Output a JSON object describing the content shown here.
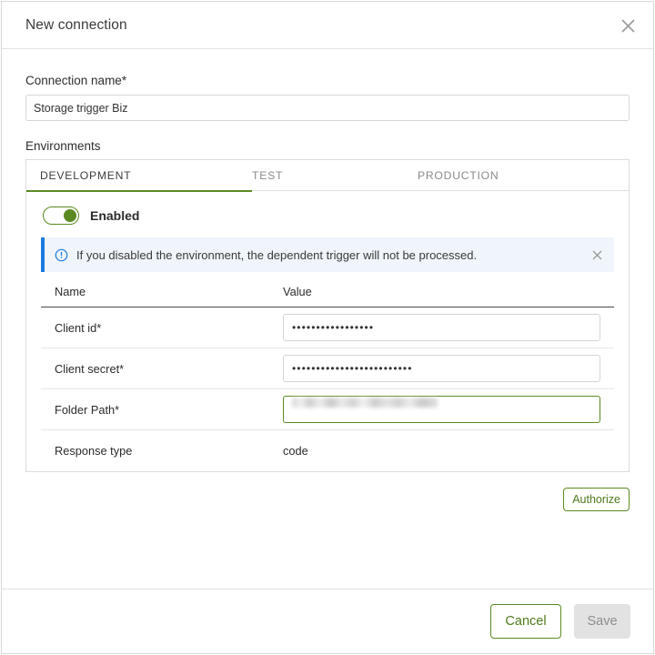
{
  "dialog": {
    "title": "New connection",
    "close_icon": "close-icon"
  },
  "connection_name": {
    "label": "Connection name*",
    "value": "Storage trigger Biz",
    "placeholder": ""
  },
  "environments": {
    "label": "Environments",
    "tabs": [
      {
        "label": "DEVELOPMENT",
        "active": true
      },
      {
        "label": "TEST",
        "active": false
      },
      {
        "label": "PRODUCTION",
        "active": false
      }
    ]
  },
  "toggle": {
    "label": "Enabled",
    "state": "on",
    "accent_color": "#5b8a22"
  },
  "banner": {
    "icon": "info-circle-icon",
    "text": "If you disabled the environment, the dependent trigger will not be processed.",
    "close_icon": "close-icon",
    "accent_color": "#1a7ae0",
    "background_color": "#eff5fb"
  },
  "table": {
    "headers": {
      "name": "Name",
      "value": "Value"
    },
    "rows": [
      {
        "name": "Client id*",
        "kind": "password",
        "value": "•••••••••••••••••",
        "focused": false
      },
      {
        "name": "Client secret*",
        "kind": "password",
        "value": "•••••••••••••••••••••••••",
        "focused": false
      },
      {
        "name": "Folder Path*",
        "kind": "redacted",
        "value": "",
        "focused": true
      },
      {
        "name": "Response type",
        "kind": "text",
        "value": "code",
        "focused": false
      }
    ]
  },
  "authorize": {
    "label": "Authorize"
  },
  "footer": {
    "cancel_label": "Cancel",
    "save_label": "Save",
    "save_disabled": true
  },
  "theme": {
    "accent_green": "#5b8a22",
    "info_blue": "#1a7ae0",
    "disabled_grey": "#e2e2e2"
  }
}
